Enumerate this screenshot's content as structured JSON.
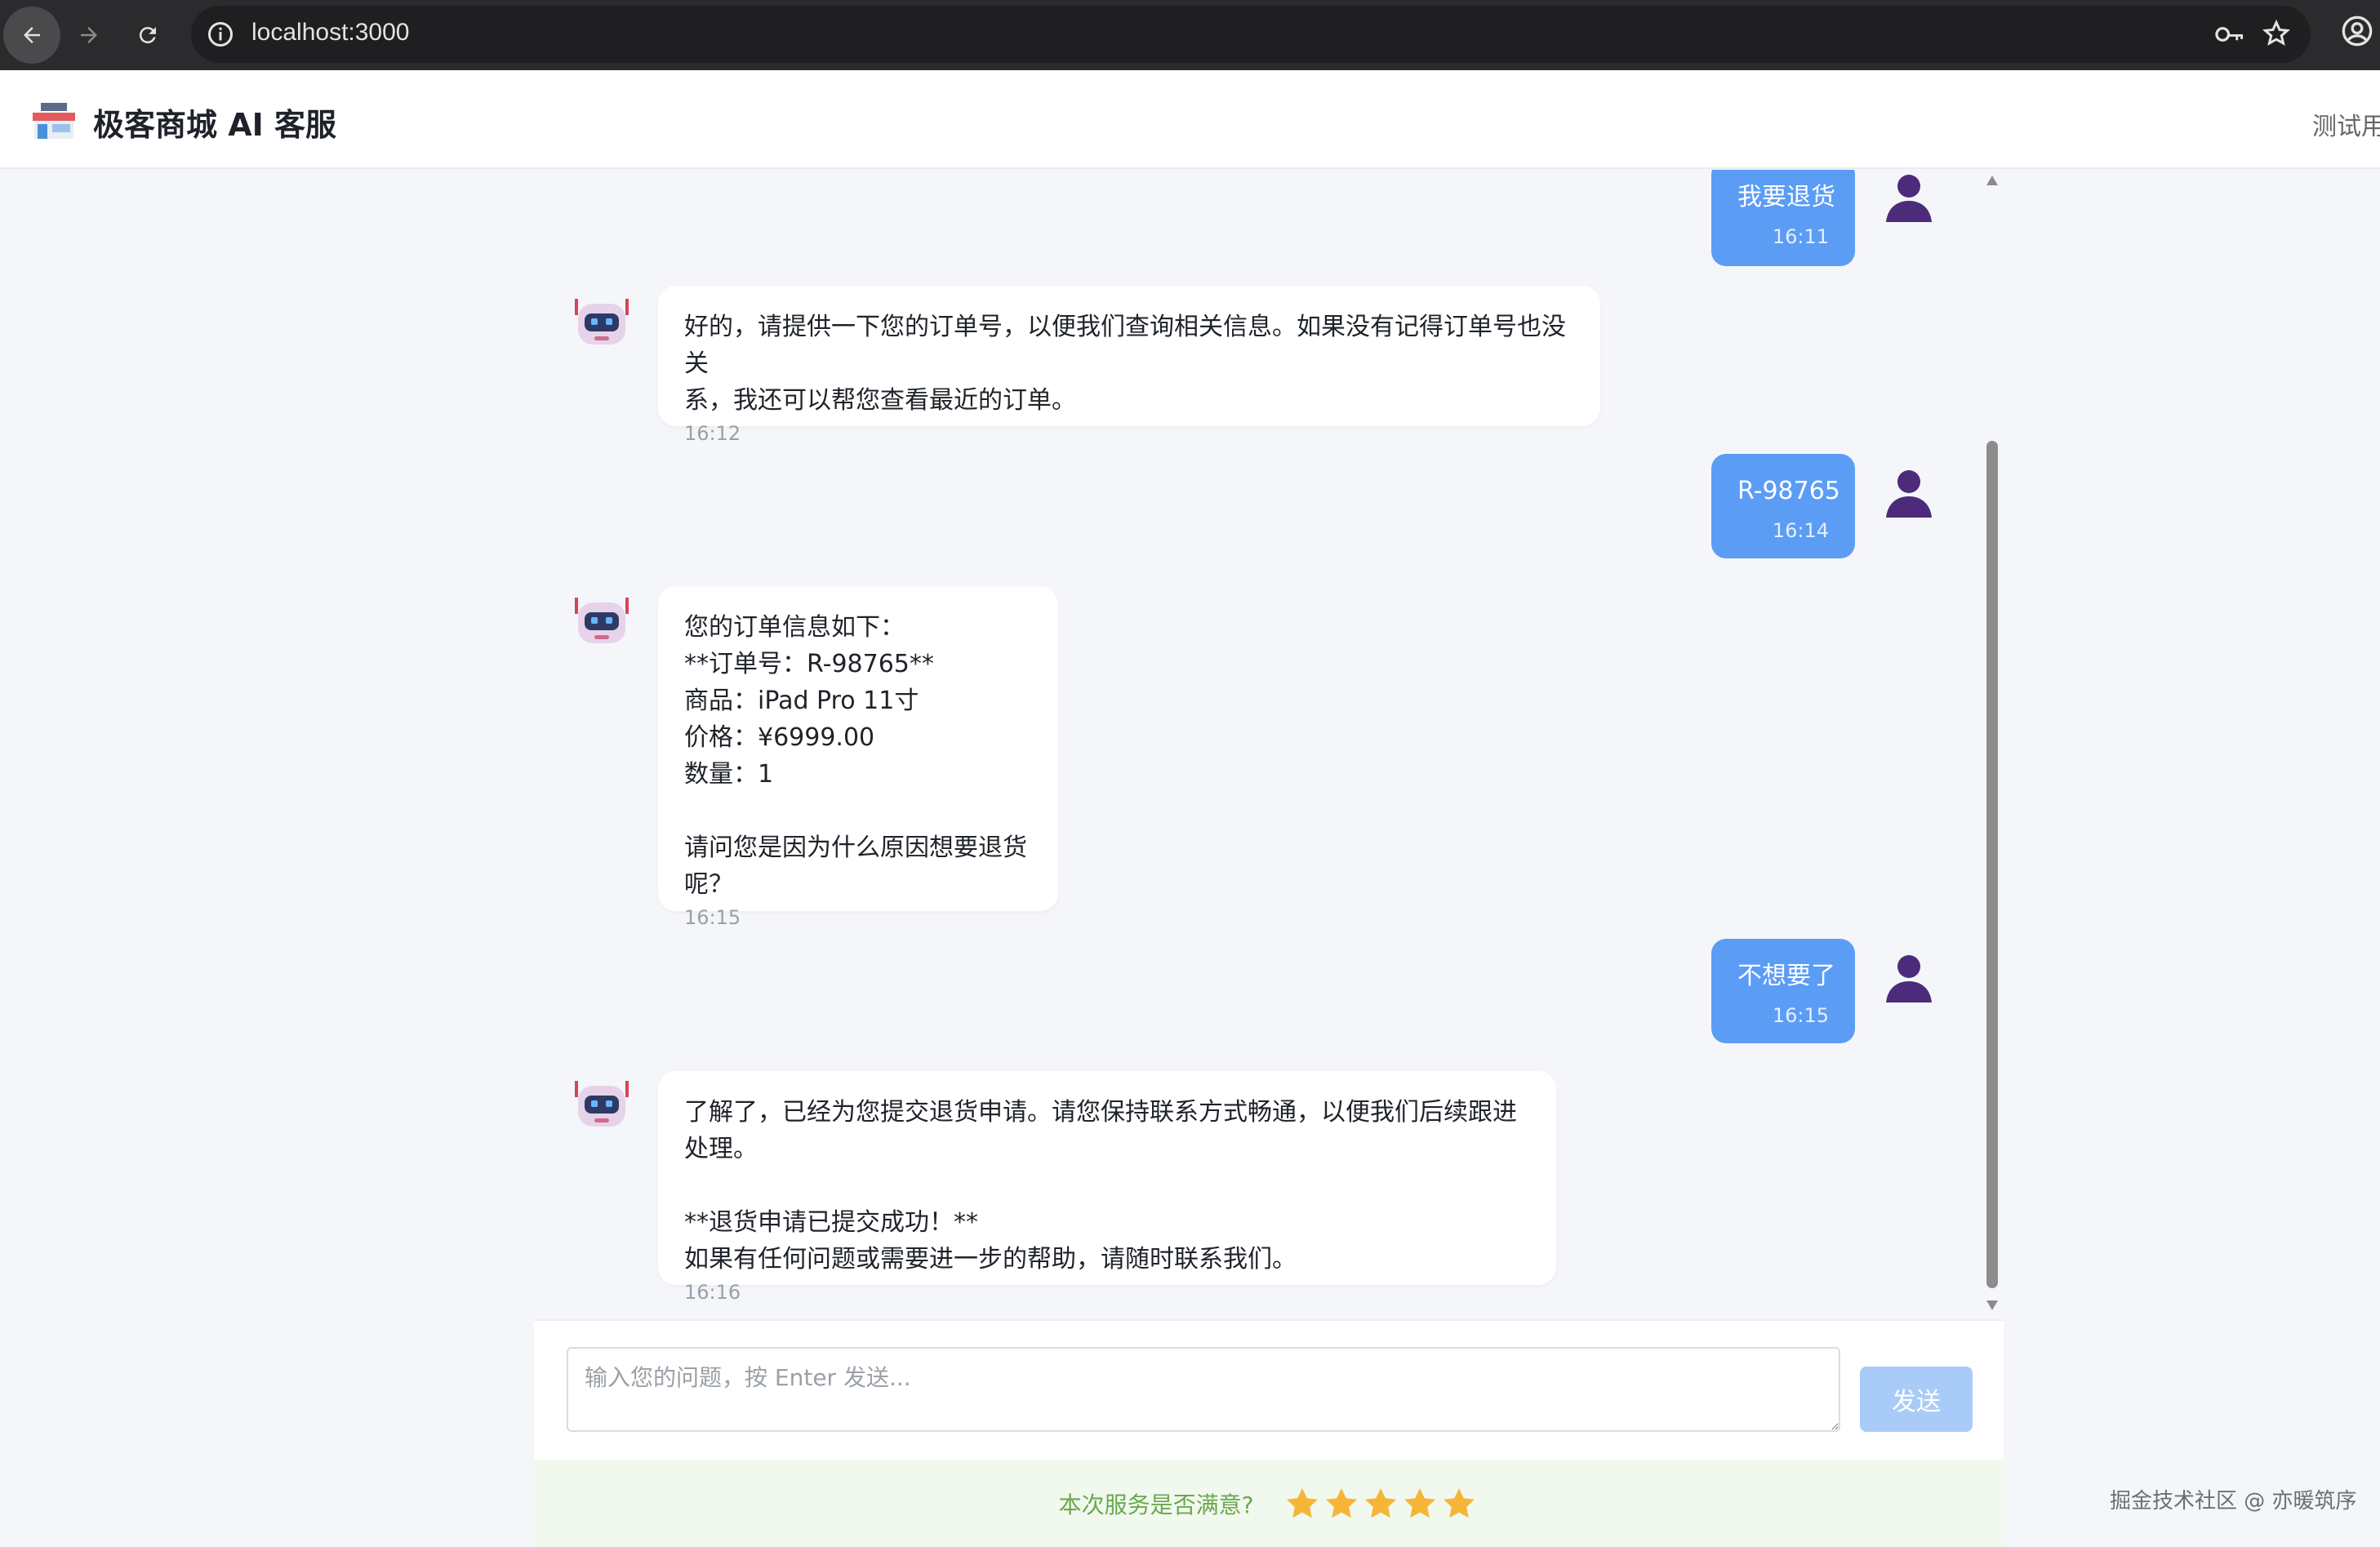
{
  "browser": {
    "url": "localhost:3000"
  },
  "header": {
    "title": "极客商城 AI 客服",
    "test_user": "测试用"
  },
  "messages": [
    {
      "role": "user",
      "text": "我要退货",
      "time": "16:11"
    },
    {
      "role": "bot",
      "text": "好的，请提供一下您的订单号，以便我们查询相关信息。如果没有记得订单号也没关\n系，我还可以帮您查看最近的订单。",
      "time": "16:12"
    },
    {
      "role": "user",
      "text": "R-98765",
      "time": "16:14"
    },
    {
      "role": "bot",
      "text": "您的订单信息如下：\n**订单号：R-98765**\n商品：iPad Pro 11寸\n价格：¥6999.00\n数量：1\n\n请问您是因为什么原因想要退货呢？",
      "time": "16:15"
    },
    {
      "role": "user",
      "text": "不想要了",
      "time": "16:15"
    },
    {
      "role": "bot",
      "text": "了解了，已经为您提交退货申请。请您保持联系方式畅通，以便我们后续跟进处理。\n\n**退货申请已提交成功！**\n如果有任何问题或需要进一步的帮助，请随时联系我们。",
      "time": "16:16"
    }
  ],
  "input": {
    "placeholder": "输入您的问题，按 Enter 发送...",
    "send_label": "发送"
  },
  "rating": {
    "question": "本次服务是否满意?",
    "stars": 5,
    "star_color": "#f5b638"
  },
  "watermark": "掘金技术社区 @ 亦暖筑序",
  "colors": {
    "user_bubble": "#5b9cf5",
    "send_button": "#a9cbf7",
    "rating_bg": "#f1f8ee"
  }
}
